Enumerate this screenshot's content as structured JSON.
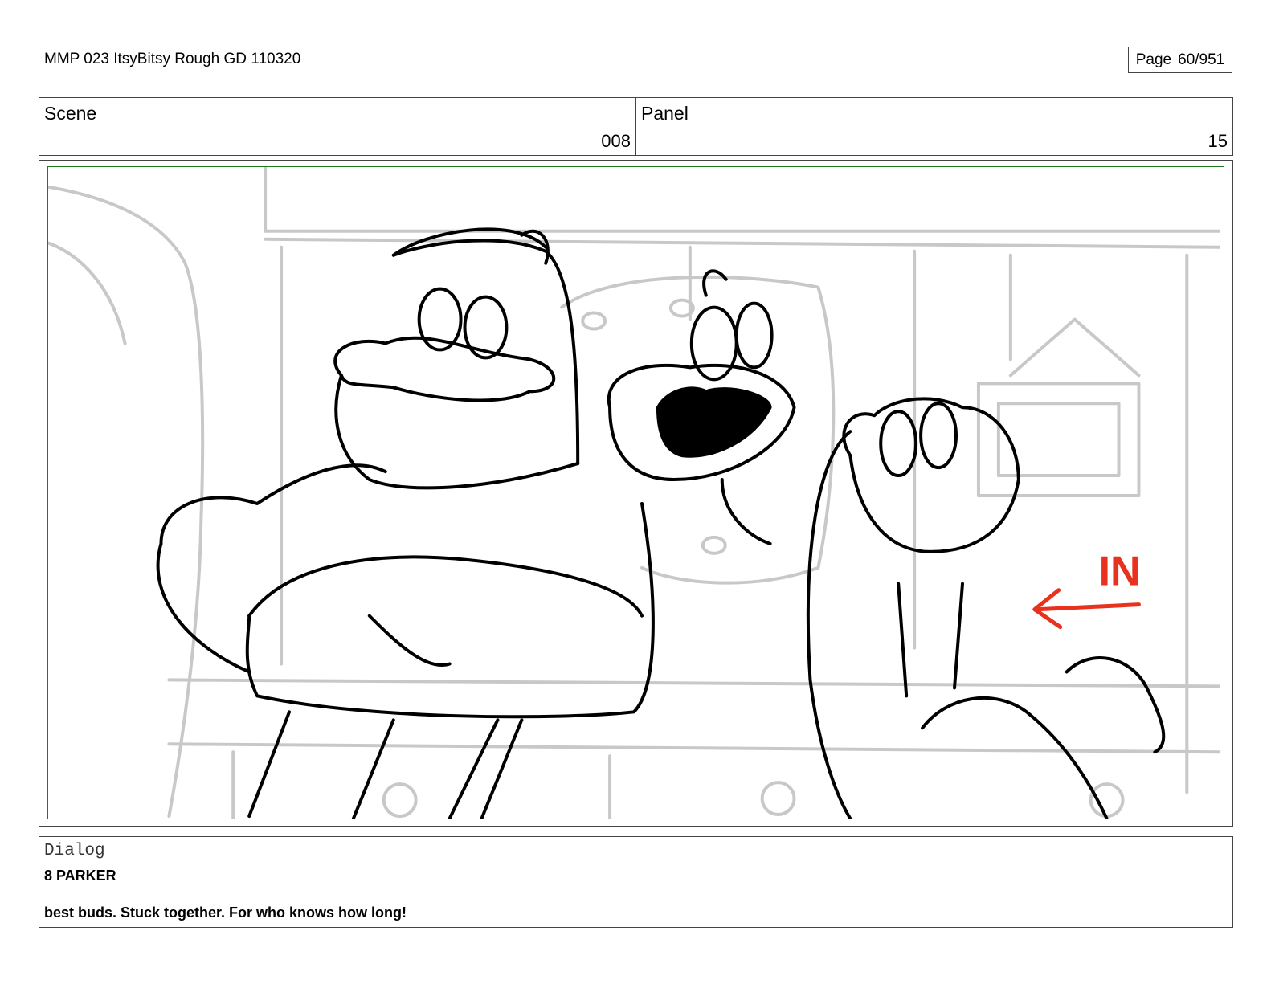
{
  "header": {
    "document_title": "MMP 023 ItsyBitsy Rough GD 110320",
    "page_label": "Page",
    "page_number": "60/951"
  },
  "info": {
    "scene_label": "Scene",
    "scene_value": "008",
    "panel_label": "Panel",
    "panel_value": "15"
  },
  "artwork": {
    "annotation_text": "IN",
    "annotation_color": "#e8321e",
    "safe_area_color": "#1f7a1f",
    "sketch_color": "#000000",
    "background_color": "#c8c8c8"
  },
  "dialog": {
    "label": "Dialog",
    "speaker": "8 PARKER",
    "line": "best buds. Stuck together. For who knows how long!"
  }
}
